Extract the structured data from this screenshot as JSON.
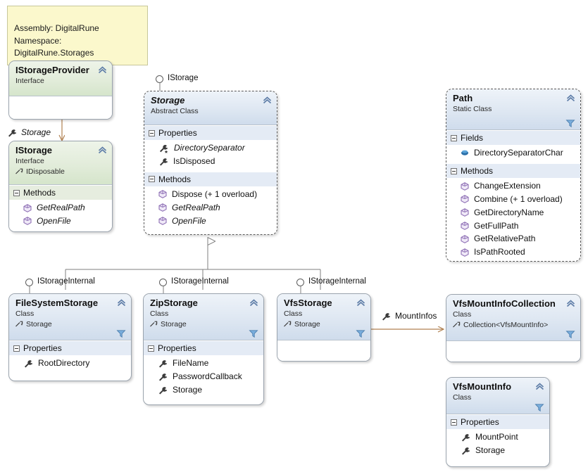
{
  "note": {
    "text": "Assembly: DigitalRune\nNamespace: DigitalRune.Storages"
  },
  "colors": {
    "note_fill": "#fbf8cc",
    "note_border": "#c7c79a",
    "class_header": "#dee7f2",
    "interface_header": "#e2ecda",
    "compartment": "#e4ebf5",
    "connector": "#7f7f7f",
    "association": "#b08050",
    "method_icon": "#8e6fb5",
    "property_icon": "#3a3a3a",
    "field_icon": "#2a6fa8",
    "funnel_icon": "#5b8dbf"
  },
  "shapes": [
    {
      "id": "istorageprovider",
      "name": "IStorageProvider",
      "stereotype": "Interface",
      "base": null,
      "kind": "interface",
      "italic_title": false,
      "dashed": false,
      "has_funnel": false,
      "compartments": []
    },
    {
      "id": "istorage",
      "name": "IStorage",
      "stereotype": "Interface",
      "base": "IDisposable",
      "kind": "interface",
      "italic_title": false,
      "dashed": false,
      "has_funnel": false,
      "compartments": [
        {
          "label": "Methods",
          "members": [
            {
              "name": "GetRealPath",
              "icon": "method-icon",
              "italic": true
            },
            {
              "name": "OpenFile",
              "icon": "method-icon",
              "italic": true
            }
          ]
        }
      ]
    },
    {
      "id": "storage",
      "name": "Storage",
      "stereotype": "Abstract Class",
      "base": null,
      "kind": "class",
      "italic_title": true,
      "dashed": true,
      "has_funnel": false,
      "compartments": [
        {
          "label": "Properties",
          "members": [
            {
              "name": "DirectorySeparator",
              "icon": "property-static-icon",
              "italic": true
            },
            {
              "name": "IsDisposed",
              "icon": "property-icon",
              "italic": false
            }
          ]
        },
        {
          "label": "Methods",
          "members": [
            {
              "name": "Dispose (+ 1 overload)",
              "icon": "method-icon",
              "italic": false
            },
            {
              "name": "GetRealPath",
              "icon": "method-icon",
              "italic": true
            },
            {
              "name": "OpenFile",
              "icon": "method-icon",
              "italic": true
            }
          ]
        }
      ]
    },
    {
      "id": "path",
      "name": "Path",
      "stereotype": "Static Class",
      "base": null,
      "kind": "class",
      "italic_title": false,
      "dashed": true,
      "has_funnel": true,
      "compartments": [
        {
          "label": "Fields",
          "members": [
            {
              "name": "DirectorySeparatorChar",
              "icon": "field-icon",
              "italic": false
            }
          ]
        },
        {
          "label": "Methods",
          "members": [
            {
              "name": "ChangeExtension",
              "icon": "method-icon",
              "italic": false
            },
            {
              "name": "Combine (+ 1 overload)",
              "icon": "method-icon",
              "italic": false
            },
            {
              "name": "GetDirectoryName",
              "icon": "method-icon",
              "italic": false
            },
            {
              "name": "GetFullPath",
              "icon": "method-icon",
              "italic": false
            },
            {
              "name": "GetRelativePath",
              "icon": "method-icon",
              "italic": false
            },
            {
              "name": "IsPathRooted",
              "icon": "method-icon",
              "italic": false
            }
          ]
        }
      ]
    },
    {
      "id": "filesystemstorage",
      "name": "FileSystemStorage",
      "stereotype": "Class",
      "base": "Storage",
      "kind": "class",
      "italic_title": false,
      "dashed": false,
      "has_funnel": true,
      "compartments": [
        {
          "label": "Properties",
          "members": [
            {
              "name": "RootDirectory",
              "icon": "property-icon",
              "italic": false
            }
          ]
        }
      ]
    },
    {
      "id": "zipstorage",
      "name": "ZipStorage",
      "stereotype": "Class",
      "base": "Storage",
      "kind": "class",
      "italic_title": false,
      "dashed": false,
      "has_funnel": true,
      "compartments": [
        {
          "label": "Properties",
          "members": [
            {
              "name": "FileName",
              "icon": "property-icon",
              "italic": false
            },
            {
              "name": "PasswordCallback",
              "icon": "property-icon",
              "italic": false
            },
            {
              "name": "Storage",
              "icon": "property-icon",
              "italic": false
            }
          ]
        }
      ]
    },
    {
      "id": "vfsstorage",
      "name": "VfsStorage",
      "stereotype": "Class",
      "base": "Storage",
      "kind": "class",
      "italic_title": false,
      "dashed": false,
      "has_funnel": true,
      "compartments": []
    },
    {
      "id": "vfsmountinfocollection",
      "name": "VfsMountInfoCollection",
      "stereotype": "Class",
      "base": "Collection<VfsMountInfo>",
      "kind": "class",
      "italic_title": false,
      "dashed": false,
      "has_funnel": true,
      "compartments": []
    },
    {
      "id": "vfsmountinfo",
      "name": "VfsMountInfo",
      "stereotype": "Class",
      "base": null,
      "kind": "class",
      "italic_title": false,
      "dashed": false,
      "has_funnel": true,
      "compartments": [
        {
          "label": "Properties",
          "members": [
            {
              "name": "MountPoint",
              "icon": "property-icon",
              "italic": false
            },
            {
              "name": "Storage",
              "icon": "property-icon",
              "italic": false
            }
          ]
        }
      ]
    }
  ],
  "lollipops": [
    {
      "id": "lolli-storage",
      "label": "IStorage"
    },
    {
      "id": "lolli-fss",
      "label": "IStorageInternal"
    },
    {
      "id": "lolli-zip",
      "label": "IStorageInternal"
    },
    {
      "id": "lolli-vfs",
      "label": "IStorageInternal"
    }
  ],
  "associations": [
    {
      "id": "assoc-storage",
      "label": "Storage",
      "italic": true
    },
    {
      "id": "assoc-mountinfos",
      "label": "MountInfos",
      "italic": false
    }
  ]
}
